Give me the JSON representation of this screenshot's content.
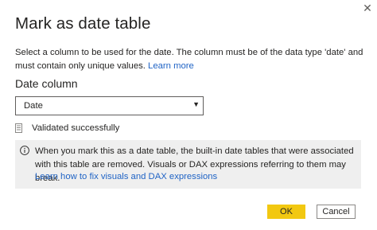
{
  "dialog": {
    "title": "Mark as date table",
    "close_glyph": "✕",
    "description": "Select a column to be used for the date. The column must be of the data type 'date' and must contain only unique values.",
    "learn_more": "Learn more"
  },
  "date_column": {
    "label": "Date column",
    "selected": "Date",
    "arrow_glyph": "▼"
  },
  "validation": {
    "status": "Validated successfully",
    "icon": "validated-document-icon"
  },
  "info": {
    "icon": "info-icon",
    "message": "When you mark this as a date table, the built-in date tables that were associated with this table are removed. Visuals or DAX expressions referring to them may break.",
    "link": "Learn how to fix visuals and DAX expressions"
  },
  "buttons": {
    "ok": "OK",
    "cancel": "Cancel"
  },
  "colors": {
    "accent": "#f2c811",
    "link": "#1f63c5",
    "info_background": "#efefef"
  }
}
